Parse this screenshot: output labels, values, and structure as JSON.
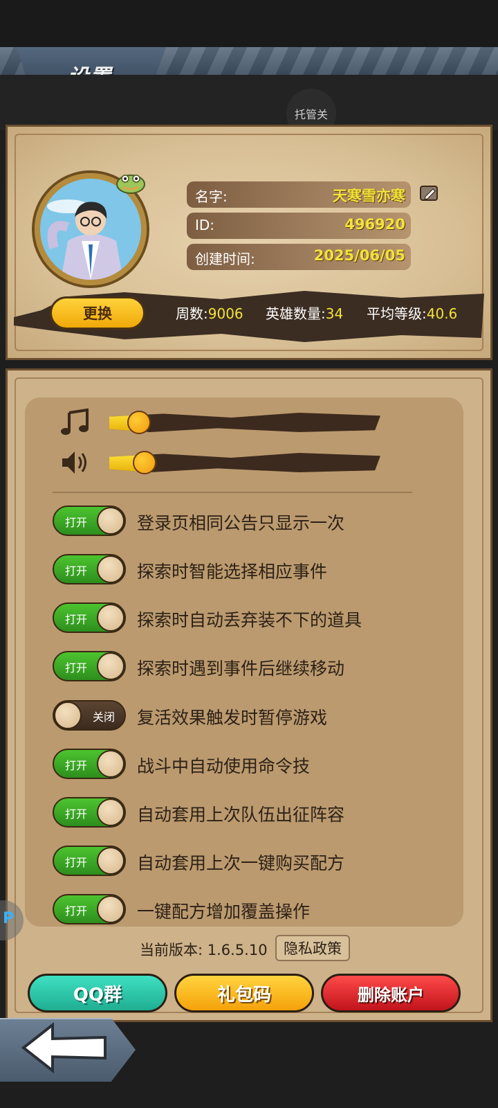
{
  "header": {
    "title": "设置",
    "managed_label": "托管关"
  },
  "profile": {
    "name_label": "名字:",
    "name_value": "天寒雪亦寒",
    "id_label": "ID:",
    "id_value": "496920",
    "created_label": "创建时间:",
    "created_value": "2025/06/05",
    "change_button": "更换",
    "stats": [
      {
        "label": "周数:",
        "value": "9006"
      },
      {
        "label": "英雄数量:",
        "value": "34"
      },
      {
        "label": "平均等级:",
        "value": "40.6"
      }
    ]
  },
  "audio": {
    "music_level": 0.11,
    "sound_level": 0.13
  },
  "toggles": [
    {
      "label": "登录页相同公告只显示一次",
      "state": "打开",
      "on": true
    },
    {
      "label": "探索时智能选择相应事件",
      "state": "打开",
      "on": true
    },
    {
      "label": "探索时自动丢弃装不下的道具",
      "state": "打开",
      "on": true
    },
    {
      "label": "探索时遇到事件后继续移动",
      "state": "打开",
      "on": true
    },
    {
      "label": "复活效果触发时暂停游戏",
      "state": "关闭",
      "on": false
    },
    {
      "label": "战斗中自动使用命令技",
      "state": "打开",
      "on": true
    },
    {
      "label": "自动套用上次队伍出征阵容",
      "state": "打开",
      "on": true
    },
    {
      "label": "自动套用上次一键购买配方",
      "state": "打开",
      "on": true
    },
    {
      "label": "一键配方增加覆盖操作",
      "state": "打开",
      "on": true
    }
  ],
  "footer": {
    "version_text": "当前版本: 1.6.5.10",
    "privacy_button": "隐私政策",
    "qq_button": "QQ群",
    "gift_button": "礼包码",
    "delete_button": "删除账户"
  },
  "icons": {
    "music": "music-note-icon",
    "sound": "speaker-icon",
    "edit": "edit-icon",
    "back": "back-arrow-icon",
    "avatar": "avatar-portrait",
    "side": "side-orb-icon"
  },
  "colors": {
    "toggle_on": "#3fb526",
    "toggle_off": "#4b3626",
    "value_yellow": "#f3e23a"
  },
  "side_orb_text": "P"
}
